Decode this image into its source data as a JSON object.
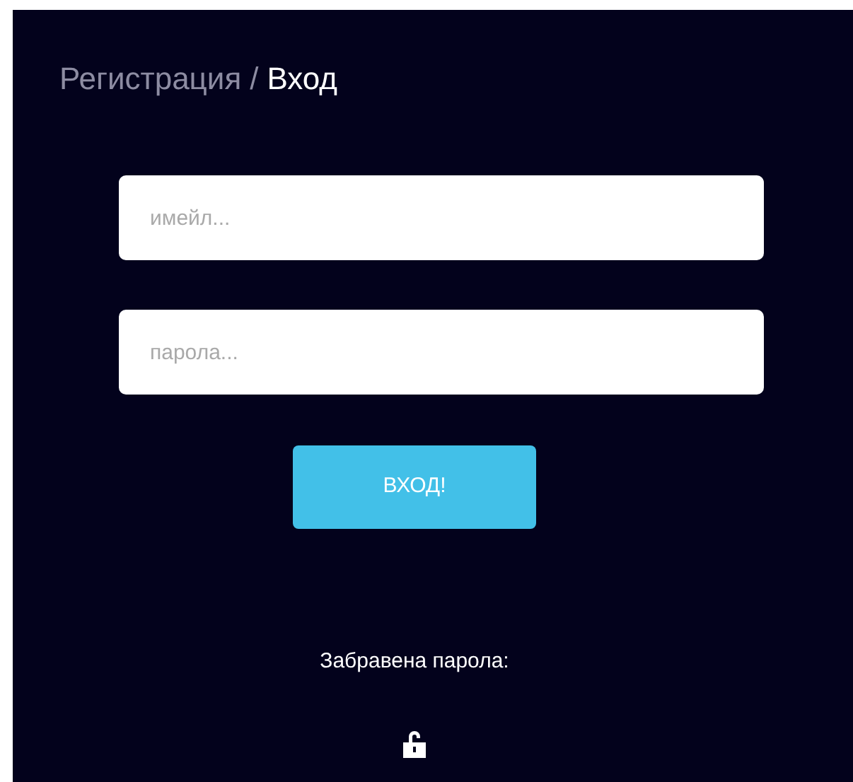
{
  "header": {
    "tabs": [
      {
        "label": "Регистрация",
        "selected": false
      },
      {
        "label": "Вход",
        "selected": true
      }
    ],
    "separator": "/"
  },
  "fields": [
    {
      "placeholder": "имейл..."
    },
    {
      "placeholder": "парола..."
    }
  ],
  "submit": "ВХОД!",
  "forgot": "Забравена парола:"
}
